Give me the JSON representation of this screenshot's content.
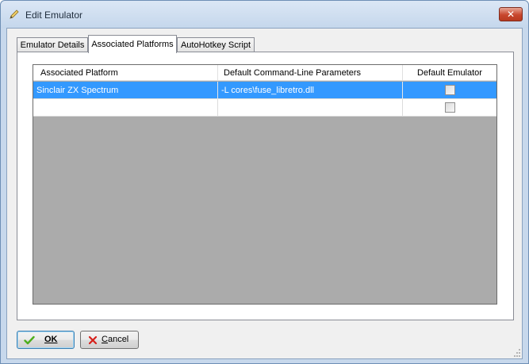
{
  "window": {
    "title": "Edit Emulator",
    "close_glyph": "✕",
    "title_icon": "pencil-icon"
  },
  "tabs": [
    {
      "label": "Emulator Details",
      "active": false
    },
    {
      "label": "Associated Platforms",
      "active": true
    },
    {
      "label": "AutoHotkey Script",
      "active": false
    }
  ],
  "grid": {
    "columns": [
      "Associated Platform",
      "Default Command-Line Parameters",
      "Default Emulator"
    ],
    "rows": [
      {
        "platform": "Sinclair ZX Spectrum",
        "params": "-L cores\\fuse_libretro.dll",
        "default": false,
        "selected": true
      },
      {
        "platform": "",
        "params": "",
        "default": false,
        "selected": false
      }
    ]
  },
  "buttons": {
    "ok_label": "OK",
    "cancel_label_first": "C",
    "cancel_label_rest": "ancel",
    "ok_icon": "checkmark-icon",
    "cancel_icon": "x-icon"
  },
  "colors": {
    "selection": "#3399ff",
    "grid_empty": "#ababab",
    "ok_icon": "#4cae1c",
    "cancel_icon": "#d6201a"
  }
}
